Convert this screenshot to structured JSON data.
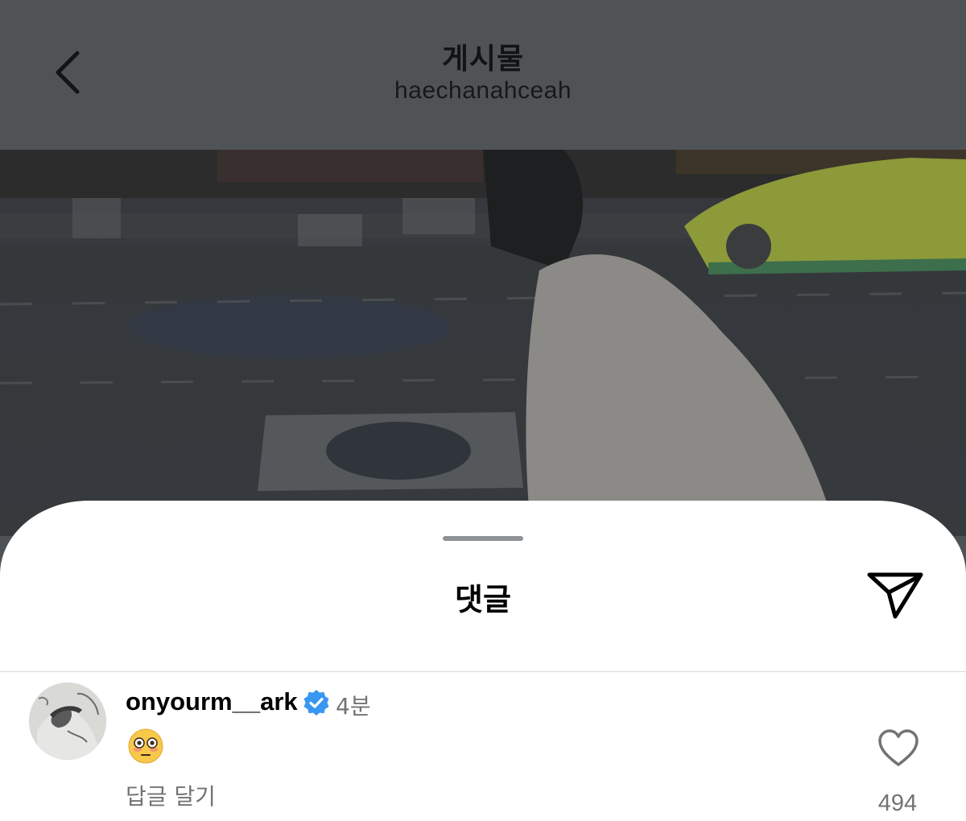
{
  "header": {
    "title": "게시물",
    "subtitle": "haechanahceah",
    "back_icon": "chevron-left-icon"
  },
  "photo": {
    "description_icon": "post-photo"
  },
  "sheet": {
    "title": "댓글",
    "share_icon": "send-icon"
  },
  "comments": [
    {
      "username": "onyourm__ark",
      "verified": true,
      "time": "4분",
      "text": "😳",
      "reply_label": "답글 달기",
      "likes": "494",
      "like_icon": "heart-outline-icon"
    }
  ],
  "colors": {
    "header_bg": "#505356",
    "verified_blue": "#3897f0",
    "muted_text": "#737373"
  }
}
